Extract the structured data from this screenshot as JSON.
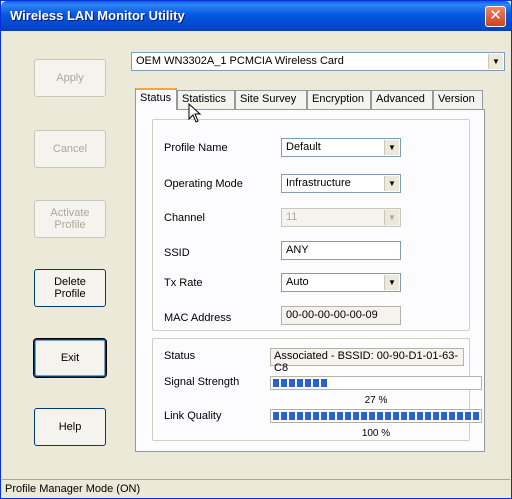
{
  "window": {
    "title": "Wireless LAN Monitor Utility"
  },
  "buttons": {
    "apply": "Apply",
    "cancel": "Cancel",
    "activate_line1": "Activate",
    "activate_line2": "Profile",
    "delete_line1": "Delete",
    "delete_line2": "Profile",
    "exit": "Exit",
    "help": "Help"
  },
  "adapter": {
    "selected": "OEM WN3302A_1 PCMCIA Wireless Card"
  },
  "tabs": [
    "Status",
    "Statistics",
    "Site Survey",
    "Encryption",
    "Advanced",
    "Version"
  ],
  "profile": {
    "profile_name_label": "Profile Name",
    "profile_name_value": "Default",
    "operating_mode_label": "Operating Mode",
    "operating_mode_value": "Infrastructure",
    "channel_label": "Channel",
    "channel_value": "11",
    "ssid_label": "SSID",
    "ssid_value": "ANY",
    "tx_rate_label": "Tx Rate",
    "tx_rate_value": "Auto",
    "mac_label": "MAC Address",
    "mac_value": "00-00-00-00-00-09"
  },
  "status": {
    "status_label": "Status",
    "status_value": "Associated - BSSID: 00-90-D1-01-63-C8",
    "signal_label": "Signal Strength",
    "signal_percent": 27,
    "signal_text": "27 %",
    "link_label": "Link Quality",
    "link_percent": 100,
    "link_text": "100 %"
  },
  "statusbar": {
    "text": "Profile Manager Mode (ON)"
  },
  "colors": {
    "titlebar": "#0a5ce8",
    "progress": "#2a5fd8",
    "tab_highlight": "#f7a535"
  }
}
